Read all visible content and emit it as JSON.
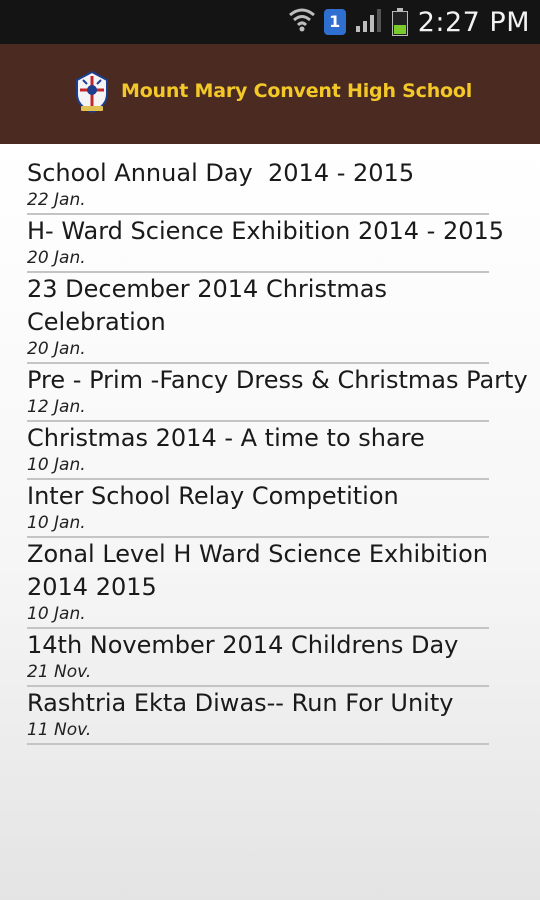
{
  "status_bar": {
    "time": "2:27 PM",
    "notification_count": "1",
    "battery_level": 0.45
  },
  "header": {
    "title": "Mount Mary Convent High School"
  },
  "news": [
    {
      "title": "School Annual Day  2014 - 2015",
      "date": "22 Jan."
    },
    {
      "title": "H- Ward Science Exhibition 2014 - 2015",
      "date": "20 Jan."
    },
    {
      "title": "23 December 2014 Christmas Celebration",
      "date": "20 Jan."
    },
    {
      "title": "Pre - Prim -Fancy Dress & Christmas Party",
      "date": "12 Jan."
    },
    {
      "title": "Christmas 2014 - A time to share",
      "date": "10 Jan."
    },
    {
      "title": "Inter School Relay Competition",
      "date": "10 Jan."
    },
    {
      "title": "Zonal Level H Ward Science Exhibition 2014 2015",
      "date": "10 Jan."
    },
    {
      "title": "14th November 2014 Childrens Day",
      "date": "21 Nov."
    },
    {
      "title": "Rashtria Ekta Diwas-- Run For Unity",
      "date": "11 Nov."
    }
  ],
  "colors": {
    "header_bg": "#4b2a21",
    "header_title": "#f3c829",
    "status_bar_bg": "#141414"
  }
}
